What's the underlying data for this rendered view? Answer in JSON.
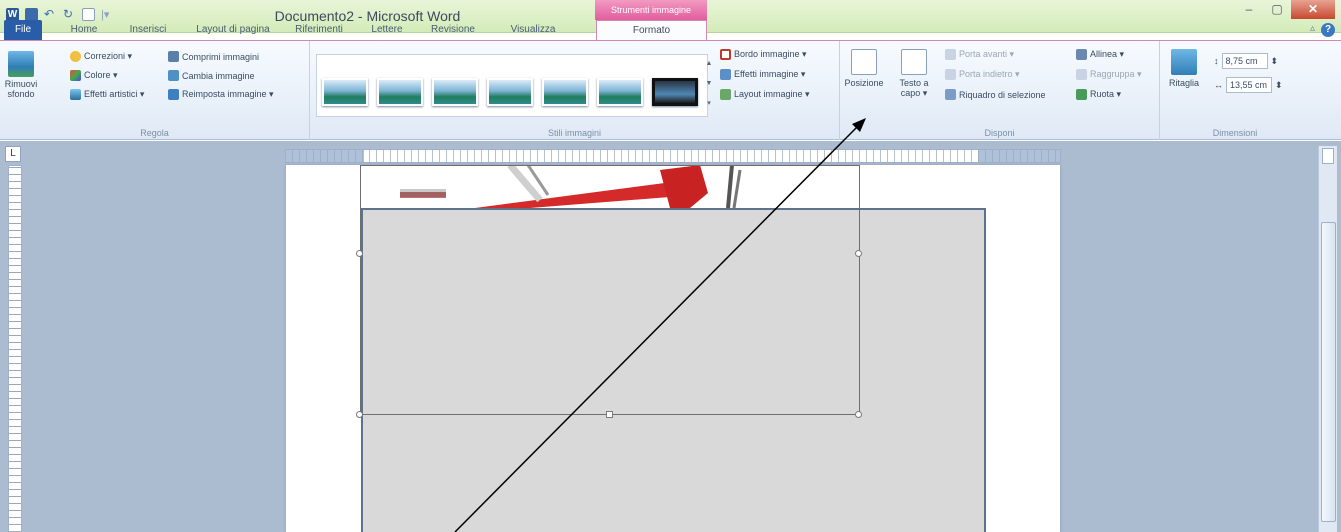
{
  "window": {
    "title": "Documento2 - Microsoft Word",
    "context_group": "Strumenti immagine",
    "controls": [
      "–",
      "▢",
      "✕"
    ]
  },
  "tabs": [
    "File",
    "Home",
    "Inserisci",
    "Layout di pagina",
    "Riferimenti",
    "Lettere",
    "Revisione",
    "Visualizza",
    "Formato"
  ],
  "active_tab": "Formato",
  "ribbon": {
    "regola": {
      "label": "Regola",
      "remove_bg": "Rimuovi sfondo",
      "correzioni": "Correzioni ▾",
      "colore": "Colore ▾",
      "effetti_artistici": "Effetti artistici ▾",
      "comprimi": "Comprimi immagini",
      "cambia": "Cambia immagine",
      "reimposta": "Reimposta immagine ▾"
    },
    "stili": {
      "label": "Stili immagini",
      "bordo": "Bordo immagine ▾",
      "effetti": "Effetti immagine ▾",
      "layout": "Layout immagine ▾"
    },
    "disponi": {
      "label": "Disponi",
      "posizione": "Posizione",
      "testo_a_capo": "Testo a capo ▾",
      "porta_avanti": "Porta avanti ▾",
      "porta_indietro": "Porta indietro ▾",
      "riquadro_selezione": "Riquadro di selezione",
      "allinea": "Allinea ▾",
      "raggruppa": "Raggruppa ▾",
      "ruota": "Ruota ▾"
    },
    "dimensioni": {
      "label": "Dimensioni",
      "ritaglia": "Ritaglia",
      "altezza": "8,75 cm",
      "larghezza": "13,55 cm"
    }
  },
  "colors": {
    "title_bar": "#d3ebb8",
    "context_tab": "#e05d9d",
    "file_tab": "#2a5da8",
    "page": "#ffffff",
    "workspace": "#abbbd0",
    "shape_fill": "#d9d9d9",
    "shape_border": "#5d738d"
  }
}
